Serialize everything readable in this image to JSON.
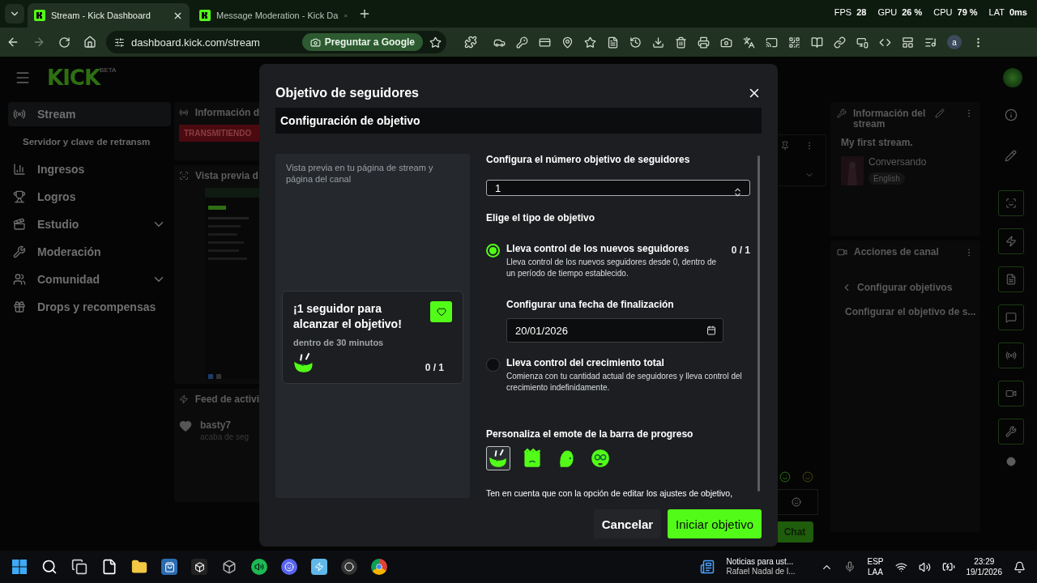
{
  "browser": {
    "tabs": [
      {
        "title": "Stream - Kick Dashboard",
        "selected": true
      },
      {
        "title": "Message Moderation - Kick Da",
        "selected": false
      }
    ],
    "url": "dashboard.kick.com/stream",
    "ask_google": "Preguntar a Google",
    "profile_initial": "a"
  },
  "perf_overlay": [
    {
      "label": "FPS",
      "value": "28"
    },
    {
      "label": "GPU",
      "value": "26 %"
    },
    {
      "label": "CPU",
      "value": "79 %"
    },
    {
      "label": "LAT",
      "value": "0ms"
    }
  ],
  "dashboard": {
    "logo": "KICK",
    "logo_tag": "BETA",
    "nav": [
      {
        "label": "Stream",
        "selected": true,
        "expandable": false,
        "children": [
          {
            "label": "Servidor y clave de retransm",
            "selected": false
          }
        ]
      },
      {
        "label": "Ingresos",
        "selected": false,
        "expandable": false
      },
      {
        "label": "Logros",
        "selected": false,
        "expandable": false
      },
      {
        "label": "Estudio",
        "selected": false,
        "expandable": true
      },
      {
        "label": "Moderación",
        "selected": false,
        "expandable": false
      },
      {
        "label": "Comunidad",
        "selected": false,
        "expandable": true
      },
      {
        "label": "Drops y recompensas",
        "selected": false,
        "expandable": false
      }
    ],
    "stream_panel": {
      "title": "Información d",
      "status": "TRANSMITIENDO"
    },
    "preview_panel": {
      "title": "Vista previa d"
    },
    "feed_panel": {
      "title": "Feed de activi",
      "events": [
        {
          "user": "basty7",
          "text": "acaba de seg"
        }
      ]
    },
    "chat": {
      "send_button": "Chat"
    },
    "info_panel": {
      "title": "Información del stream",
      "stream_title": "My first stream.",
      "category": "Conversando",
      "language": "English"
    },
    "actions_panel": {
      "title": "Acciones de canal",
      "back_label": "Configurar objetivos",
      "items": [
        "Configurar el objetivo de s..."
      ]
    }
  },
  "modal": {
    "title": "Objetivo de seguidores",
    "section": "Configuración de objetivo",
    "preview_caption": "Vista previa en tu página de stream y página del canal",
    "preview_card": {
      "title": "¡1 seguidor para alcanzar el objetivo!",
      "subtitle": "dentro de 30 minutos",
      "progress": "0 / 1"
    },
    "target_label": "Configura el número objetivo de seguidores",
    "target_value": "1",
    "type_label": "Elige el tipo de objetivo",
    "goal_types": [
      {
        "title": "Lleva control de los nuevos seguidores",
        "description": "Lleva control de los nuevos seguidores desde 0, dentro de un período de tiempo establecido.",
        "selected": true,
        "progress": "0 / 1",
        "end_date_label": "Configurar una fecha de finalización",
        "end_date": "20/01/2026"
      },
      {
        "title": "Lleva control del crecimiento total",
        "description": "Comienza con tu cantidad actual de seguidores y lleva control del crecimiento indefinidamente.",
        "selected": false
      }
    ],
    "emote_label": "Personaliza el emote de la barra de progreso",
    "emotes": [
      {
        "kind": "hands",
        "selected": true
      },
      {
        "kind": "box",
        "selected": false
      },
      {
        "kind": "blob",
        "selected": false
      },
      {
        "kind": "glasses",
        "selected": false
      }
    ],
    "note": "Ten en cuenta que con la opción de editar los ajustes de objetivo,",
    "cancel": "Cancelar",
    "confirm": "Iniciar objetivo"
  },
  "taskbar": {
    "news_title": "Noticias para ust...",
    "news_subtitle": "Rafael Nadal de l...",
    "language": "ESP",
    "layout": "LAA",
    "time": "23:29",
    "date": "19/1/2026"
  }
}
